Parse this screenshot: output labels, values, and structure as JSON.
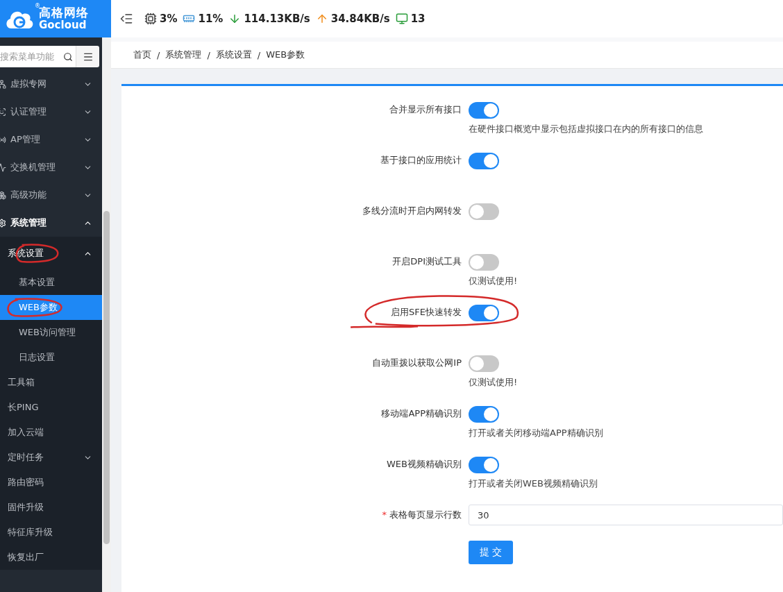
{
  "logo": {
    "name": "高格网络",
    "mark": "®",
    "subtitle": "Gocloud"
  },
  "stats": [
    {
      "kind": "cpu",
      "value": "3%"
    },
    {
      "kind": "memory",
      "value": "11%"
    },
    {
      "kind": "download",
      "value": "114.13KB/s"
    },
    {
      "kind": "upload",
      "value": "34.84KB/s"
    },
    {
      "kind": "devices",
      "value": "13"
    }
  ],
  "sidebar": {
    "search": {
      "placeholder": "搜索菜单功能"
    },
    "items": [
      {
        "label": "虚拟专网",
        "expanded": false,
        "selected": false
      },
      {
        "label": "认证管理",
        "expanded": false,
        "selected": false
      },
      {
        "label": "AP管理",
        "expanded": false,
        "selected": false
      },
      {
        "label": "交换机管理",
        "expanded": false,
        "selected": false
      },
      {
        "label": "高级功能",
        "expanded": false,
        "selected": false
      },
      {
        "label": "系统管理",
        "expanded": true,
        "selected": false,
        "children": [
          {
            "label": "系统设置",
            "expanded": true,
            "selected": false,
            "marked": true,
            "children": [
              {
                "label": "基本设置",
                "selected": false
              },
              {
                "label": "WEB参数",
                "selected": true,
                "marked": true
              },
              {
                "label": "WEB访问管理",
                "selected": false
              },
              {
                "label": "日志设置",
                "selected": false
              }
            ]
          },
          {
            "label": "工具箱",
            "selected": false
          },
          {
            "label": "长PING",
            "selected": false
          },
          {
            "label": "加入云端",
            "selected": false
          },
          {
            "label": "定时任务",
            "expanded": false,
            "selected": false
          },
          {
            "label": "路由密码",
            "selected": false
          },
          {
            "label": "固件升级",
            "selected": false
          },
          {
            "label": "特征库升级",
            "selected": false
          },
          {
            "label": "恢复出厂",
            "selected": false
          }
        ]
      }
    ]
  },
  "breadcrumb": {
    "separator": "/",
    "items": [
      "首页",
      "系统管理",
      "系统设置",
      "WEB参数"
    ]
  },
  "form": {
    "fields": [
      {
        "kind": "toggle",
        "label": "合并显示所有接口",
        "on": true,
        "hint": "在硬件接口概览中显示包括虚拟接口在内的所有接口的信息"
      },
      {
        "kind": "toggle",
        "label": "基于接口的应用统计",
        "on": true
      },
      {
        "kind": "toggle",
        "label": "多线分流时开启内网转发",
        "on": false
      },
      {
        "kind": "toggle",
        "label": "开启DPI测试工具",
        "on": false,
        "hint": "仅测试使用!"
      },
      {
        "kind": "toggle",
        "label": "启用SFE快速转发",
        "on": true,
        "marked": true
      },
      {
        "kind": "toggle",
        "label": "自动重拨以获取公网IP",
        "on": false,
        "hint": "仅测试使用!"
      },
      {
        "kind": "toggle",
        "label": "移动端APP精确识别",
        "on": true,
        "hint": "打开或者关闭移动端APP精确识别"
      },
      {
        "kind": "toggle",
        "label": "WEB视频精确识别",
        "on": true,
        "hint": "打开或者关闭WEB视频精确识别"
      },
      {
        "kind": "input",
        "label": "表格每页显示行数",
        "required": "*",
        "value": "30"
      }
    ],
    "submit": "提 交"
  }
}
